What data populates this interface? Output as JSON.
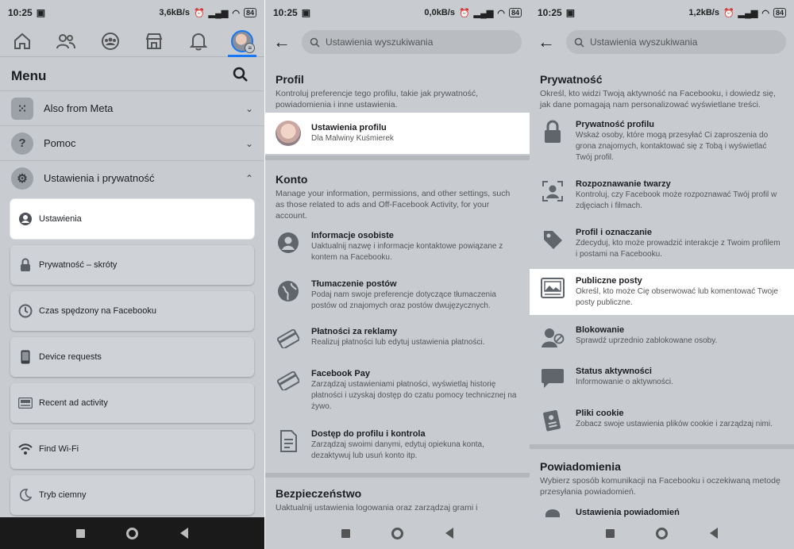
{
  "status_bars": [
    {
      "time": "10:25",
      "speed": "3,6kB/s",
      "battery": "84"
    },
    {
      "time": "10:25",
      "speed": "0,0kB/s",
      "battery": "84"
    },
    {
      "time": "10:25",
      "speed": "1,2kB/s",
      "battery": "84"
    }
  ],
  "menu": {
    "title": "Menu",
    "sections": [
      {
        "label": "Also from Meta"
      },
      {
        "label": "Pomoc"
      },
      {
        "label": "Ustawienia i prywatność"
      }
    ],
    "cards": [
      {
        "label": "Ustawienia"
      },
      {
        "label": "Prywatność – skróty"
      },
      {
        "label": "Czas spędzony na Facebooku"
      },
      {
        "label": "Device requests"
      },
      {
        "label": "Recent ad activity"
      },
      {
        "label": "Find Wi-Fi"
      },
      {
        "label": "Tryb ciemny"
      }
    ]
  },
  "settings": {
    "search_placeholder": "Ustawienia wyszukiwania",
    "profile": {
      "heading": "Profil",
      "desc": "Kontroluj preferencje tego profilu, takie jak prywatność, powiadomienia i inne ustawienia.",
      "item_title": "Ustawienia profilu",
      "item_sub": "Dla Malwiny Kuśmierek"
    },
    "account": {
      "heading": "Konto",
      "desc": "Manage your information, permissions, and other settings, such as those related to ads and Off-Facebook Activity, for your account.",
      "items": [
        {
          "title": "Informacje osobiste",
          "desc": "Uaktualnij nazwę i informacje kontaktowe powiązane z kontem na Facebooku."
        },
        {
          "title": "Tłumaczenie postów",
          "desc": "Podaj nam swoje preferencje dotyczące tłumaczenia postów od znajomych oraz postów dwujęzycznych."
        },
        {
          "title": "Płatności za reklamy",
          "desc": "Realizuj płatności lub edytuj ustawienia płatności."
        },
        {
          "title": "Facebook Pay",
          "desc": "Zarządzaj ustawieniami płatności, wyświetlaj historię płatności i uzyskaj dostęp do czatu pomocy technicznej na żywo."
        },
        {
          "title": "Dostęp do profilu i kontrola",
          "desc": "Zarządzaj swoimi danymi, edytuj opiekuna konta, dezaktywuj lub usuń konto itp."
        }
      ]
    },
    "security": {
      "heading": "Bezpieczeństwo",
      "desc": "Uaktualnij ustawienia logowania oraz zarządzaj grami i"
    }
  },
  "privacy": {
    "search_placeholder": "Ustawienia wyszukiwania",
    "heading": "Prywatność",
    "desc": "Określ, kto widzi Twoją aktywność na Facebooku, i dowiedz się, jak dane pomagają nam personalizować wyświetlane treści.",
    "items": [
      {
        "title": "Prywatność profilu",
        "desc": "Wskaż osoby, które mogą przesyłać Ci zaproszenia do grona znajomych, kontaktować się z Tobą i wyświetlać Twój profil."
      },
      {
        "title": "Rozpoznawanie twarzy",
        "desc": "Kontroluj, czy Facebook może rozpoznawać Twój profil w zdjęciach i filmach."
      },
      {
        "title": "Profil i oznaczanie",
        "desc": "Zdecyduj, kto może prowadzić interakcje z Twoim profilem i postami na Facebooku."
      },
      {
        "title": "Publiczne posty",
        "desc": "Określ, kto może Cię obserwować lub komentować Twoje posty publiczne."
      },
      {
        "title": "Blokowanie",
        "desc": "Sprawdź uprzednio zablokowane osoby."
      },
      {
        "title": "Status aktywności",
        "desc": "Informowanie o aktywności."
      },
      {
        "title": "Pliki cookie",
        "desc": "Zobacz swoje ustawienia plików cookie i zarządzaj nimi."
      }
    ],
    "notifications": {
      "heading": "Powiadomienia",
      "desc": "Wybierz sposób komunikacji na Facebooku i oczekiwaną metodę przesyłania powiadomień.",
      "item_title": "Ustawienia powiadomień"
    }
  }
}
